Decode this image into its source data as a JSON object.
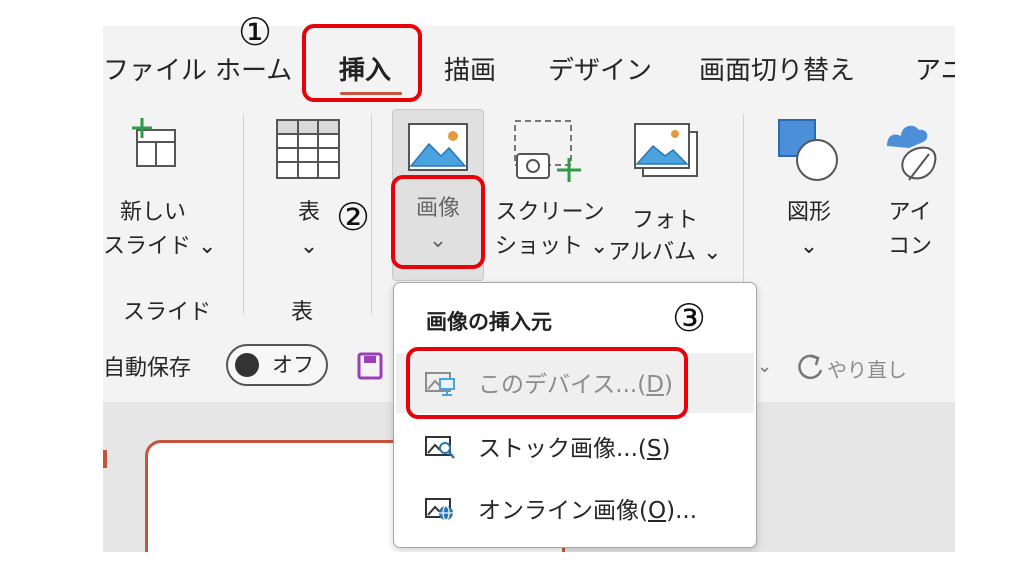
{
  "tabs": [
    {
      "label": "ファイル"
    },
    {
      "label": "ホーム"
    },
    {
      "label": "挿入",
      "active": true
    },
    {
      "label": "描画"
    },
    {
      "label": "デザイン"
    },
    {
      "label": "画面切り替え"
    },
    {
      "label": "アニ"
    }
  ],
  "ribbon": {
    "new_slide": {
      "line1": "新しい",
      "line2": "スライド ⌄"
    },
    "table": {
      "line1": "表",
      "line2": "⌄"
    },
    "image": {
      "line1": "画像",
      "line2": "⌄"
    },
    "screenshot": {
      "line1": "スクリーン",
      "line2": "ショット ⌄"
    },
    "photo_album": {
      "line1": "フォト",
      "line2": "アルバム ⌄"
    },
    "shapes": {
      "line1": "図形",
      "line2": "⌄"
    },
    "icons": {
      "line1": "アイ",
      "line2": "コン"
    },
    "groups": {
      "slides": "スライド",
      "tables": "表"
    }
  },
  "qat": {
    "autosave_label": "自動保存",
    "autosave_state": "オフ",
    "redo_label": "やり直し"
  },
  "dropdown": {
    "header": "画像の挿入元",
    "items": [
      {
        "prefix": "このデバイス...(",
        "key": "D",
        "suffix": ")",
        "disabled": true,
        "icon": "device-image-icon"
      },
      {
        "prefix": "ストック画像...(",
        "key": "S",
        "suffix": ")",
        "disabled": false,
        "icon": "stock-image-icon"
      },
      {
        "prefix": "オンライン画像(",
        "key": "O",
        "suffix": ")...",
        "disabled": false,
        "icon": "online-image-icon"
      }
    ]
  },
  "annotations": {
    "step1": "①",
    "step2": "②",
    "step3": "③",
    "highlight_color": "#e8000b"
  },
  "colors": {
    "accent": "#c4553b",
    "ribbon_bg": "#f3f3f3"
  }
}
